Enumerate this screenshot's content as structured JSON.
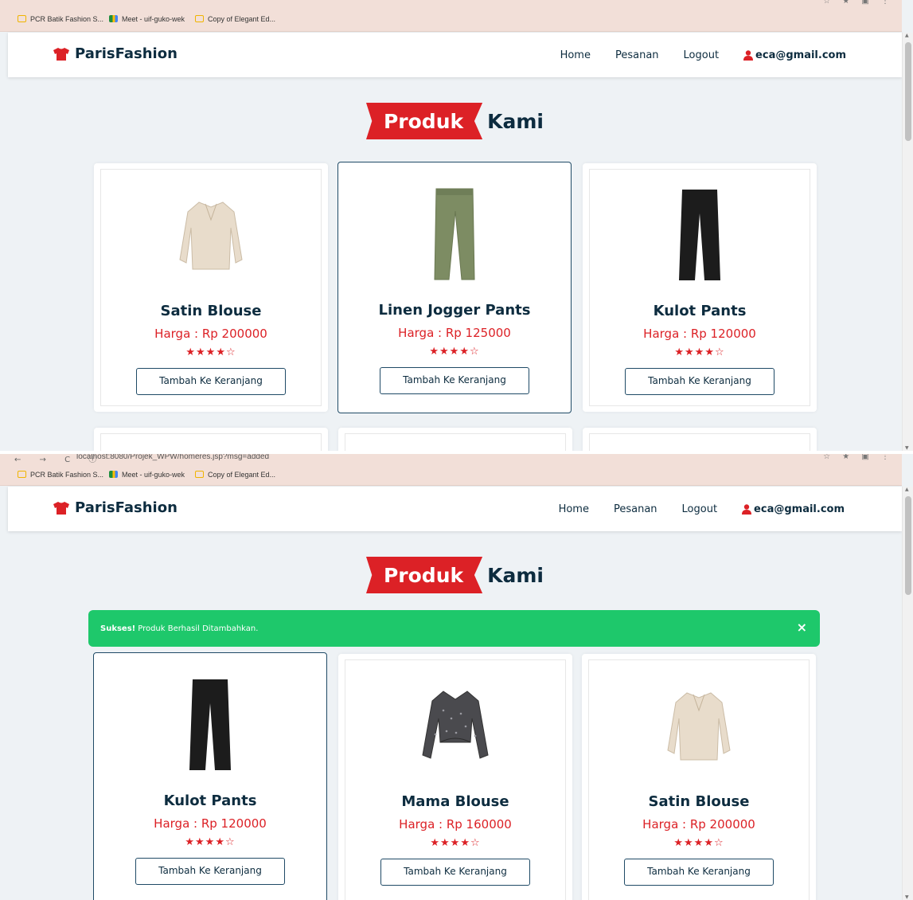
{
  "browser": {
    "url_text": "localhost:8080/Projek_WPW/homeres.jsp?msg=added",
    "nav_glyphs": "← → C ⓘ",
    "right_glyphs": "☆ ★ ▣ ⋮",
    "bookmarks": [
      {
        "label": "PCR Batik Fashion S...",
        "icon": "folder-icon"
      },
      {
        "label": "Meet - uif-guko-wek",
        "icon": "meet-icon"
      },
      {
        "label": "Copy of Elegant Ed...",
        "icon": "slides-icon"
      }
    ]
  },
  "navbar": {
    "brand": "ParisFashion",
    "links": [
      "Home",
      "Pesanan",
      "Logout"
    ],
    "email": "eca@gmail.com"
  },
  "heading": {
    "highlight": "Produk",
    "rest": "Kami"
  },
  "alert": {
    "strong": "Sukses!",
    "message": "Produk Berhasil Ditambahkan.",
    "close": "×"
  },
  "button_label": "Tambah Ke Keranjang",
  "stars": "★★★★☆",
  "screen1": {
    "products": [
      {
        "name": "Satin Blouse",
        "price": "Harga : Rp 200000",
        "image": "satin-blouse"
      },
      {
        "name": "Linen Jogger Pants",
        "price": "Harga : Rp 125000",
        "image": "jogger-pants"
      },
      {
        "name": "Kulot Pants",
        "price": "Harga : Rp 120000",
        "image": "kulot-pants"
      }
    ]
  },
  "screen2": {
    "products": [
      {
        "name": "Kulot Pants",
        "price": "Harga : Rp 120000",
        "image": "kulot-pants"
      },
      {
        "name": "Mama Blouse",
        "price": "Harga : Rp 160000",
        "image": "mama-blouse"
      },
      {
        "name": "Satin Blouse",
        "price": "Harga : Rp 200000",
        "image": "satin-blouse"
      }
    ]
  },
  "colors": {
    "brand_red": "#dc2126",
    "navy": "#0d2c3f",
    "success": "#1ec86b",
    "background": "#eef2f5"
  }
}
